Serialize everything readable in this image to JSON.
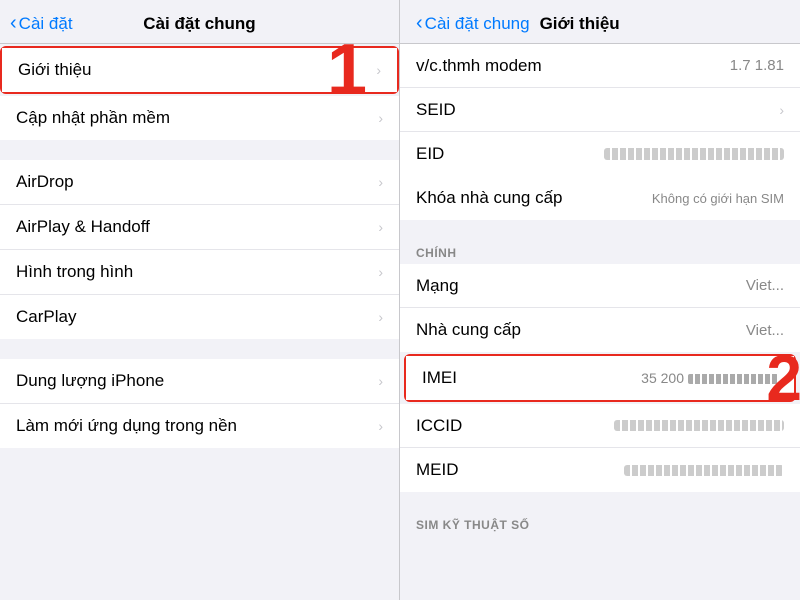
{
  "left": {
    "nav_back_label": "Cài đặt",
    "nav_title": "Cài đặt chung",
    "step1_badge": "1",
    "items_group1": [
      {
        "id": "gioi-thieu",
        "label": "Giới thiệu",
        "highlighted": true
      },
      {
        "id": "cap-nhat",
        "label": "Cập nhật phần mềm",
        "highlighted": false
      }
    ],
    "items_group2": [
      {
        "id": "airdrop",
        "label": "AirDrop",
        "highlighted": false
      },
      {
        "id": "airplay",
        "label": "AirPlay & Handoff",
        "highlighted": false
      },
      {
        "id": "hinh",
        "label": "Hình trong hình",
        "highlighted": false
      },
      {
        "id": "carplay",
        "label": "CarPlay",
        "highlighted": false
      }
    ],
    "items_group3": [
      {
        "id": "dung-luong",
        "label": "Dung lượng iPhone",
        "highlighted": false
      },
      {
        "id": "lam-moi",
        "label": "Làm mới ứng dụng trong nền",
        "highlighted": false
      }
    ]
  },
  "right": {
    "nav_back_label": "Cài đặt chung",
    "nav_title": "Giới thiệu",
    "step2_badge": "2",
    "top_rows": [
      {
        "id": "modem",
        "label": "v/c.thmh modem",
        "value": "1.7 1.81"
      },
      {
        "id": "seid",
        "label": "SEID",
        "value": "",
        "chevron": true
      },
      {
        "id": "eid",
        "label": "EID",
        "value": "blurred1"
      }
    ],
    "section_chinh": "CHÍNH",
    "chinh_rows": [
      {
        "id": "mang",
        "label": "Mạng",
        "value": "Viet..."
      },
      {
        "id": "nha-cung-cap",
        "label": "Nhà cung cấp",
        "value": "Viet..."
      }
    ],
    "imei_row": {
      "label": "IMEI",
      "value": "35 200... ●●●●●●●...",
      "highlighted": true
    },
    "bottom_rows": [
      {
        "id": "iccid",
        "label": "ICCID",
        "value": "blurred2"
      },
      {
        "id": "meid",
        "label": "MEID",
        "value": "blurred3"
      }
    ],
    "section_sim": "SIM KỸ THUẬT SỐ",
    "khoa_row": {
      "label": "Khóa nhà cung cấp",
      "value": "Không có giới hạn SIM"
    }
  }
}
